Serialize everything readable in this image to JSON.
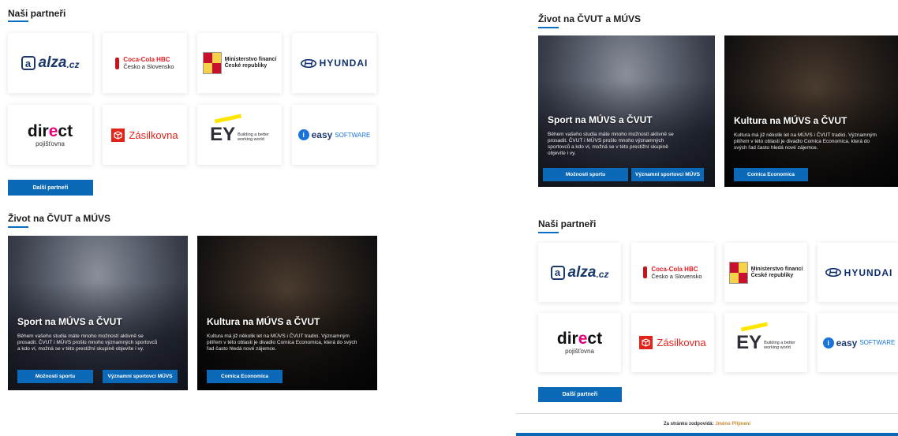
{
  "partners": {
    "title": "Naši partneři",
    "more_button": "Další partneři",
    "logos": [
      {
        "key": "alza",
        "text": "alza",
        "suffix": ".cz",
        "icon": "a"
      },
      {
        "key": "coca",
        "line1": "Coca-Cola HBC",
        "line2": "Česko a Slovensko"
      },
      {
        "key": "mf",
        "line1": "Ministerstvo financí",
        "line2": "České republiky"
      },
      {
        "key": "hyundai",
        "text": "HYUNDAI",
        "icon": "hyundai-h-icon"
      },
      {
        "key": "direct",
        "line1a": "dir",
        "line1b": "e",
        "line1c": "ct",
        "line2": "pojišťovna"
      },
      {
        "key": "zasilkovna",
        "text": "Zásilkovna"
      },
      {
        "key": "ey",
        "text": "EY",
        "tag1": "Building a better",
        "tag2": "working world"
      },
      {
        "key": "easy",
        "text": "easy",
        "suffix": "SOFTWARE",
        "icon": "i"
      }
    ]
  },
  "life": {
    "title": "Život na ČVUT a MÚVS",
    "cards": [
      {
        "title": "Sport na MÚVS a ČVUT",
        "text": "Během vašeho studia máte mnoho možností aktivně se prosadit. ČVUT i MÚVS prošlo mnoho významných sportovců a kdo ví, možná se v této prestižní skupině objevíte i vy.",
        "buttons": [
          "Možnosti sportu",
          "Významní sportovci MÚVS"
        ]
      },
      {
        "title": "Kultura na MÚVS a ČVUT",
        "text": "Kultura má již několik let na MÚVS i ČVUT tradici. Významným pilířem v této oblasti je divadlo Comica Economica, která do svých řad často hledá nové zájemce.",
        "buttons": [
          "Comica Economica"
        ]
      }
    ]
  },
  "footer": {
    "label": "Za stránku zodpovídá:",
    "name": "Jméno Příjmení"
  },
  "colors": {
    "accent": "#0b69b8",
    "title_line": "#0a6fc2",
    "footer_name": "#c48a2c"
  }
}
